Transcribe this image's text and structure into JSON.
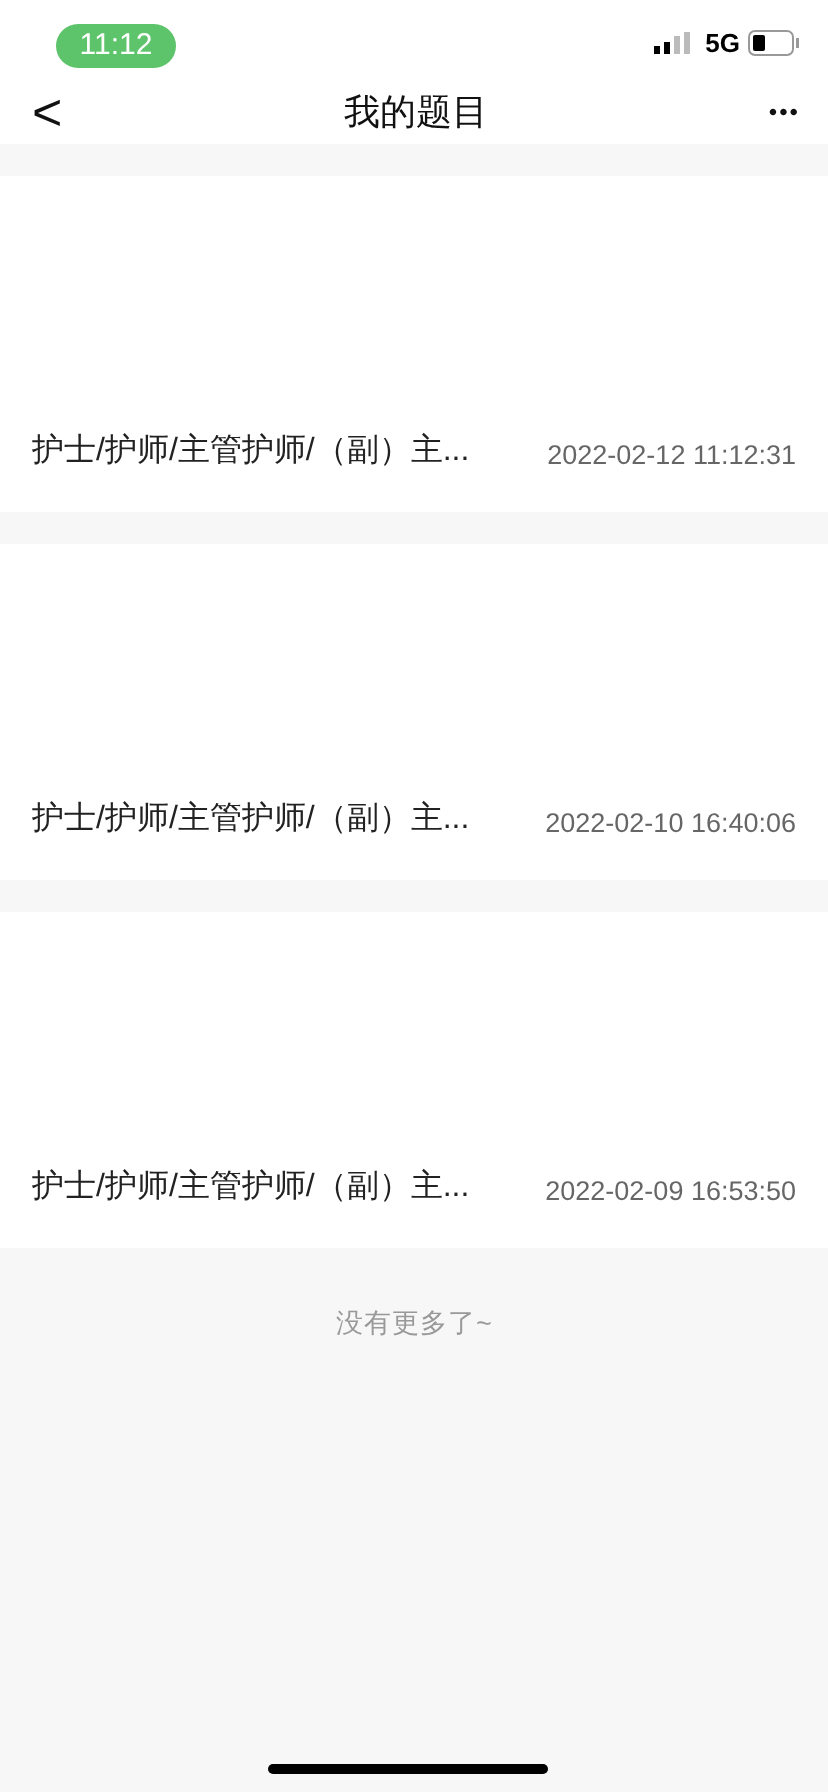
{
  "status_bar": {
    "time": "11:12",
    "network": "5G"
  },
  "nav": {
    "back": "<",
    "title": "我的题目",
    "more": "•••"
  },
  "records": [
    {
      "title": "护士/护师/主管护师/（副）主...",
      "date": "2022-02-12 11:12:31"
    },
    {
      "title": "护士/护师/主管护师/（副）主...",
      "date": "2022-02-10 16:40:06"
    },
    {
      "title": "护士/护师/主管护师/（副）主...",
      "date": "2022-02-09 16:53:50"
    }
  ],
  "end_note": "没有更多了~"
}
